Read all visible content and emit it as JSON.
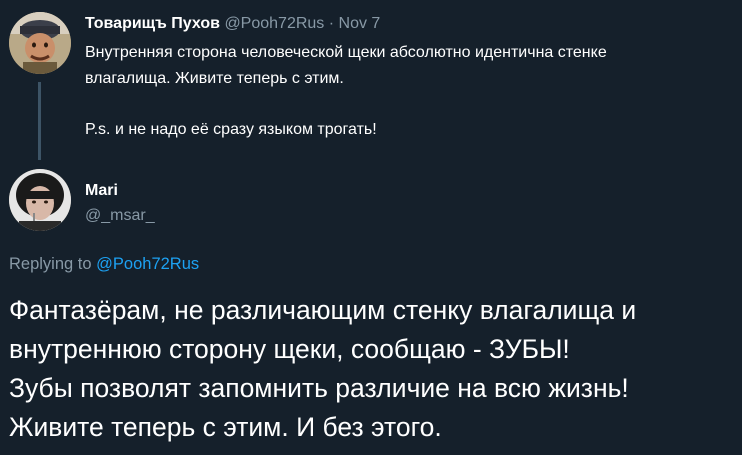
{
  "parent_tweet": {
    "author_name": "Товарищъ Пухов",
    "handle": "@Pooh72Rus",
    "separator": "·",
    "date": "Nov 7",
    "text_line1": "Внутренняя сторона человеческой щеки абсолютно идентична стенке",
    "text_line2": "влагалища. Живите теперь с этим.",
    "text_ps": "P.s. и не надо её сразу языком трогать!"
  },
  "reply_tweet": {
    "author_name": "Mari",
    "handle": "@_msar_",
    "replying_prefix": "Replying to",
    "replying_handle": "@Pooh72Rus",
    "text_lines": [
      "Фантазёрам, не различающим стенку влагалища и",
      "внутреннюю сторону щеки, сообщаю - ЗУБЫ!",
      "Зубы позволят запомнить различие на всю жизнь!",
      "Живите теперь с этим. И без этого."
    ]
  },
  "colors": {
    "background": "#15202b",
    "text": "#ffffff",
    "muted": "#8899a6",
    "link": "#1da1f2",
    "thread_line": "#3d5466"
  }
}
